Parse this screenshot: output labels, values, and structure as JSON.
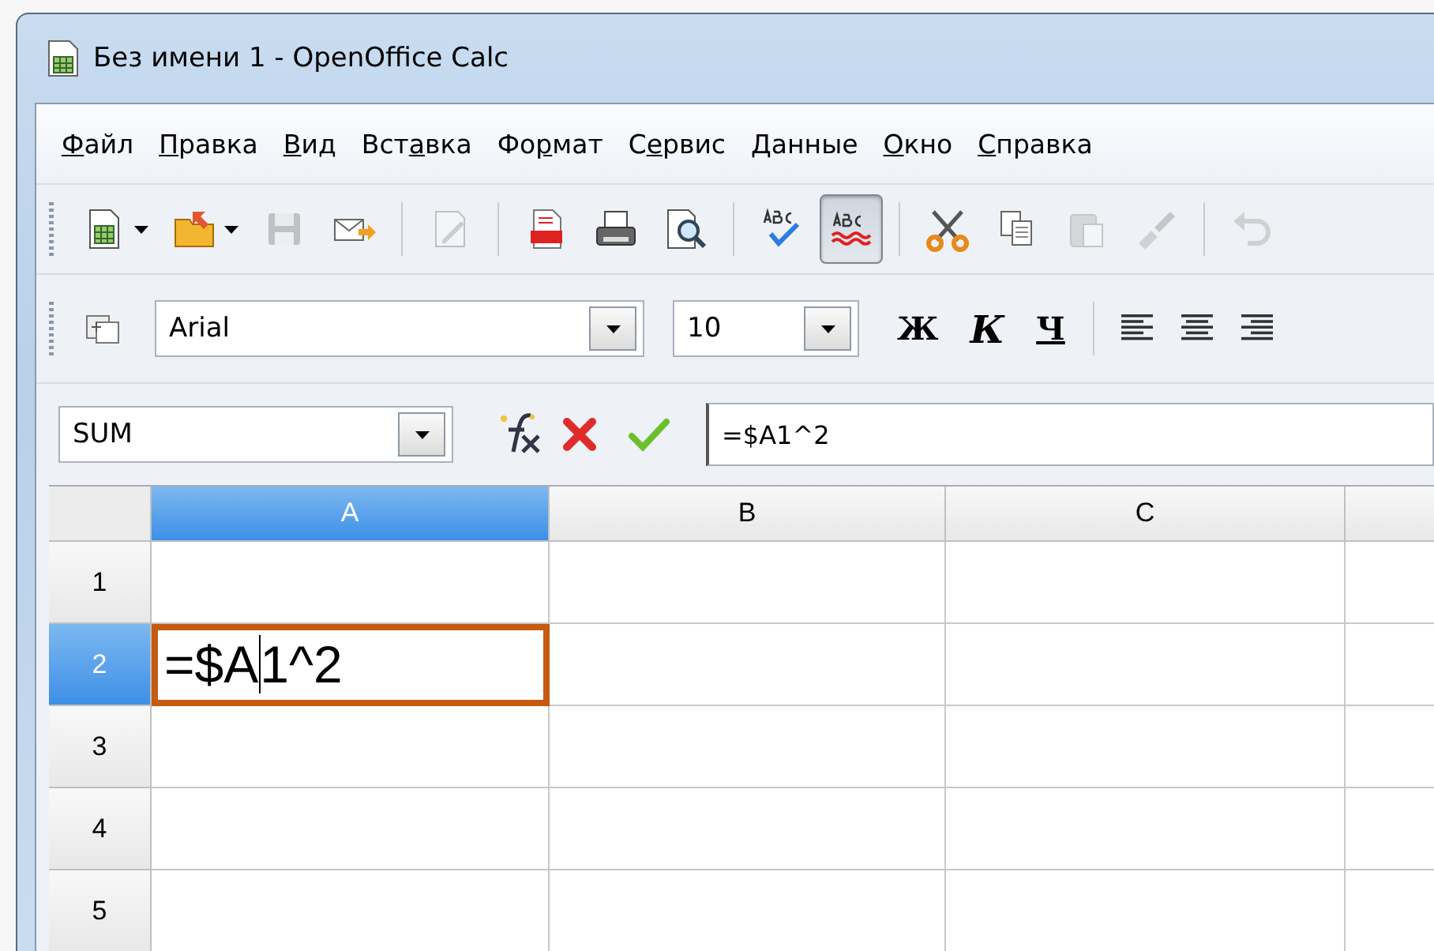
{
  "window": {
    "title": "Без имени 1 - OpenOffice Calc"
  },
  "menu": [
    {
      "key": "Ф",
      "after": "айл"
    },
    {
      "key": "П",
      "after": "равка"
    },
    {
      "key": "В",
      "after": "ид"
    },
    {
      "before": "Вст",
      "key": "а",
      "after": "вка"
    },
    {
      "before": "Фо",
      "key": "р",
      "after": "мат"
    },
    {
      "before": "С",
      "key": "е",
      "after": "рвис"
    },
    {
      "key": "Д",
      "after": "анные"
    },
    {
      "key": "О",
      "after": "кно"
    },
    {
      "key": "С",
      "after": "правка"
    }
  ],
  "standard_toolbar": [
    {
      "kind": "button",
      "disabled": false,
      "pressed": false,
      "dropdown": true
    },
    {
      "kind": "button",
      "disabled": false,
      "pressed": false,
      "dropdown": true
    },
    {
      "kind": "button",
      "disabled": true,
      "pressed": false,
      "dropdown": false
    },
    {
      "kind": "button",
      "disabled": false,
      "pressed": false,
      "dropdown": false
    },
    {
      "kind": "separator"
    },
    {
      "kind": "button",
      "disabled": true,
      "pressed": false,
      "dropdown": false
    },
    {
      "kind": "separator"
    },
    {
      "kind": "button",
      "disabled": false,
      "pressed": false,
      "dropdown": false
    },
    {
      "kind": "button",
      "disabled": false,
      "pressed": false,
      "dropdown": false
    },
    {
      "kind": "button",
      "disabled": false,
      "pressed": false,
      "dropdown": false
    },
    {
      "kind": "separator"
    },
    {
      "kind": "button",
      "disabled": false,
      "pressed": false,
      "dropdown": false
    },
    {
      "kind": "button",
      "disabled": false,
      "pressed": true,
      "dropdown": false
    },
    {
      "kind": "separator"
    },
    {
      "kind": "button",
      "disabled": false,
      "pressed": false,
      "dropdown": false
    },
    {
      "kind": "button",
      "disabled": false,
      "pressed": false,
      "dropdown": false
    },
    {
      "kind": "button",
      "disabled": true,
      "pressed": false,
      "dropdown": false
    },
    {
      "kind": "button",
      "disabled": true,
      "pressed": false,
      "dropdown": false
    },
    {
      "kind": "separator"
    },
    {
      "kind": "button",
      "disabled": true,
      "pressed": false,
      "dropdown": false
    }
  ],
  "formatting_toolbar": {
    "font_name": "Arial",
    "font_size": "10",
    "bold": "Ж",
    "italic": "К",
    "underline": "Ч"
  },
  "formula_bar": {
    "name_box": "SUM",
    "formula": "=$A1^2"
  },
  "grid": {
    "columns": [
      {
        "label": "A",
        "selected": true
      },
      {
        "label": "B",
        "selected": false
      },
      {
        "label": "C",
        "selected": false
      }
    ],
    "rows": [
      {
        "label": "1",
        "selected": false,
        "cells": [
          {
            "editing": false
          },
          {
            "editing": false
          },
          {
            "editing": false
          }
        ]
      },
      {
        "label": "2",
        "selected": true,
        "cells": [
          {
            "editing": true,
            "text_before_caret": "=$A",
            "text_after_caret": "1^2"
          },
          {
            "editing": false
          },
          {
            "editing": false
          }
        ]
      },
      {
        "label": "3",
        "selected": false,
        "cells": [
          {
            "editing": false
          },
          {
            "editing": false
          },
          {
            "editing": false
          }
        ]
      },
      {
        "label": "4",
        "selected": false,
        "cells": [
          {
            "editing": false
          },
          {
            "editing": false
          },
          {
            "editing": false
          }
        ]
      },
      {
        "label": "5",
        "selected": false,
        "cells": [
          {
            "editing": false
          },
          {
            "editing": false
          },
          {
            "editing": false
          }
        ]
      }
    ]
  }
}
